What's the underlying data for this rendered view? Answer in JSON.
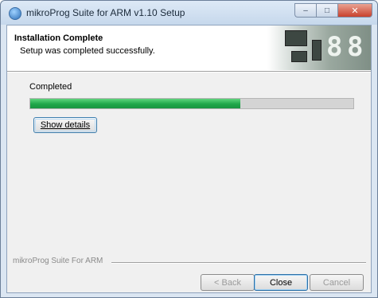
{
  "window": {
    "title": "mikroProg Suite for ARM v1.10 Setup"
  },
  "caption_buttons": {
    "minimize": "–",
    "maximize": "□",
    "close": "✕"
  },
  "header": {
    "title": "Installation Complete",
    "subtitle": "Setup was completed successfully."
  },
  "progress": {
    "label": "Completed",
    "fraction": 0.65,
    "fill_color": "#1fa74a"
  },
  "details_button": {
    "label": "Show details"
  },
  "footer": {
    "brand": "mikroProg Suite For ARM",
    "back_label": "< Back",
    "close_label": "Close",
    "cancel_label": "Cancel"
  }
}
